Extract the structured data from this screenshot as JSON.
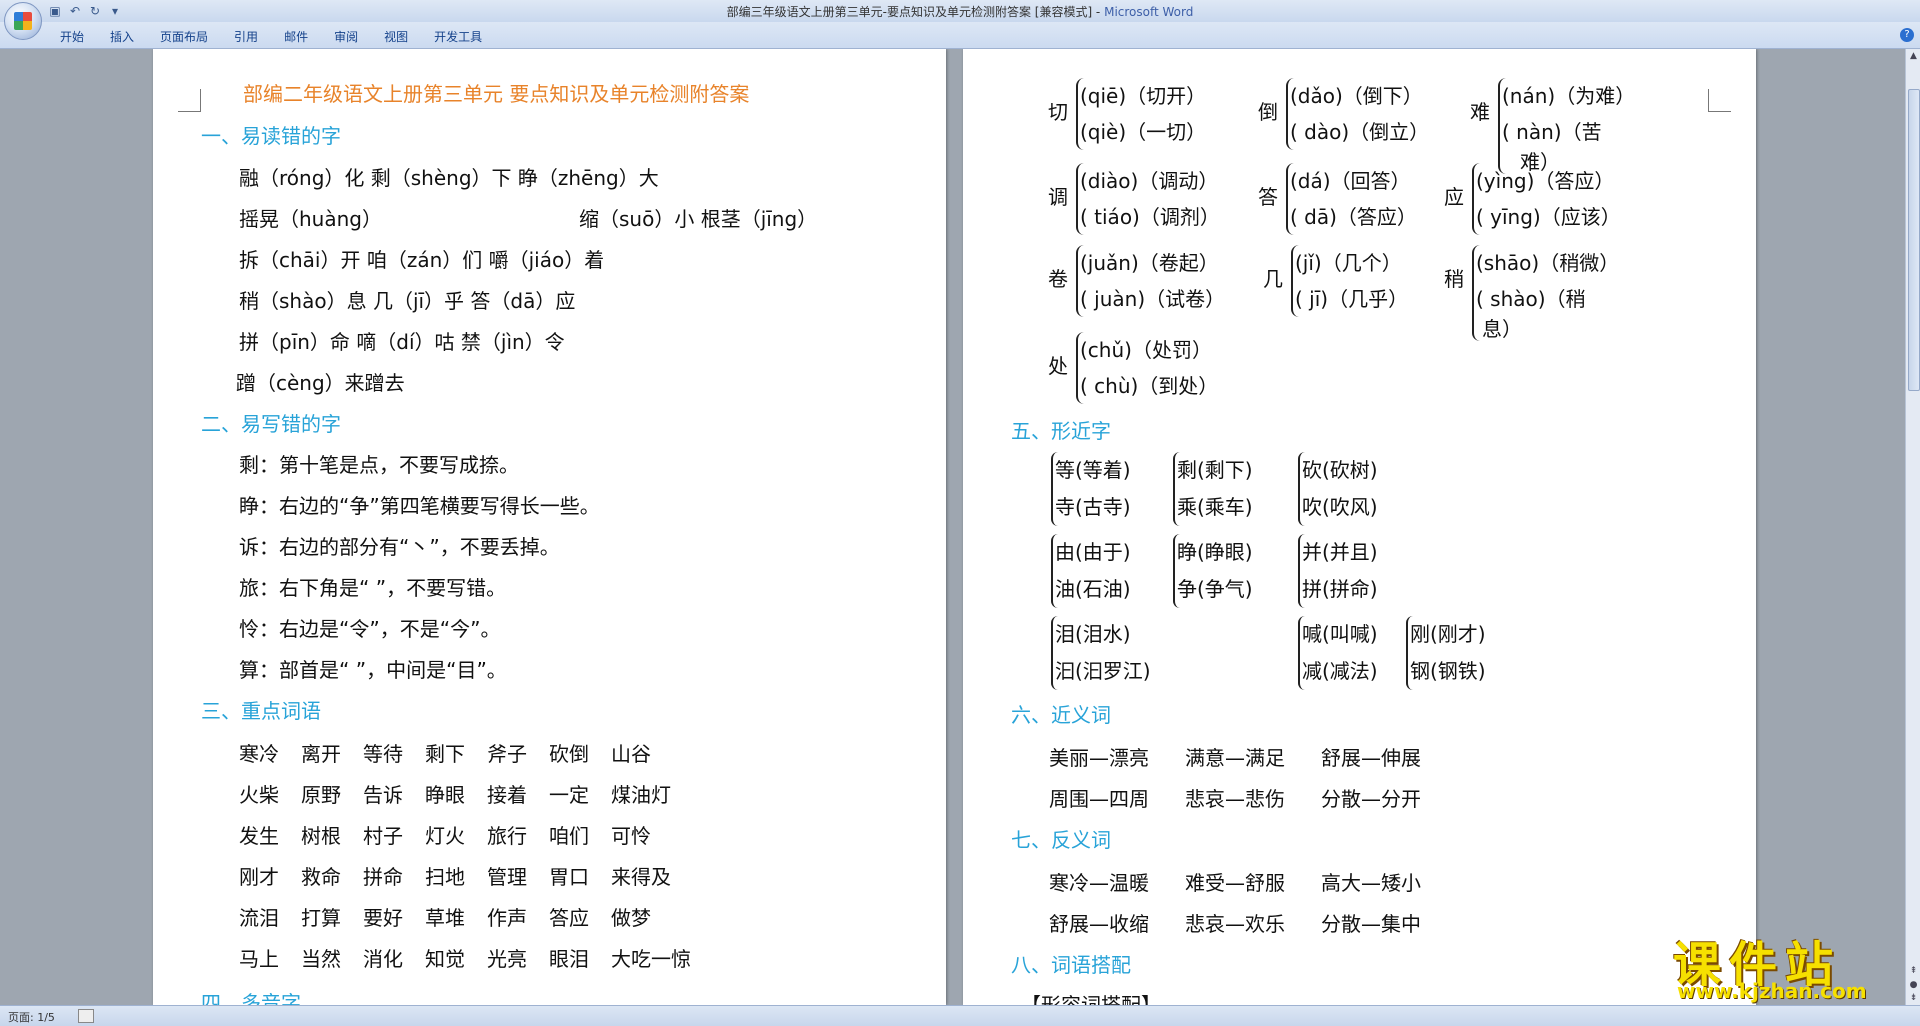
{
  "window": {
    "title": "部编三年级语文上册第三单元-要点知识及单元检测附答案 [兼容模式] - ",
    "app": "Microsoft Word"
  },
  "ribbon": {
    "tabs": [
      "开始",
      "插入",
      "页面布局",
      "引用",
      "邮件",
      "审阅",
      "视图",
      "开发工具"
    ]
  },
  "status": {
    "page": "页面: 1/5"
  },
  "watermark": {
    "brand": "课件站",
    "url": "www.kjzhan.com"
  },
  "doc": {
    "title": "部编二年级语文上册第三单元  要点知识及单元检测附答案",
    "s1": {
      "heading": "一、易读错的字",
      "lines": [
        "融（róng）化   剩（shèng）下   睁（zhēng）大",
        "摇晃（huàng）",
        "缩（suō）小     根茎（jīng）",
        "拆（chāi）开    咱（zán）们      嚼（jiáo）着",
        "稍（shào）息    几（jī）乎        答（dā）应",
        "拼（pīn）命     嘀（dí）咕        禁（jìn）令",
        "蹭（cèng）来蹭去"
      ]
    },
    "s2": {
      "heading": "二、易写错的字",
      "lines": [
        "剩：第十笔是点，不要写成捺。",
        "睁：右边的“争”第四笔横要写得长一些。",
        "诉：右边的部分有“丶”，不要丢掉。",
        "旅：右下角是“ ”，不要写错。",
        "怜：右边是“令”，不是“今”。",
        "算：部首是“  ”，中间是“目”。"
      ]
    },
    "s3": {
      "heading": "三、重点词语",
      "rows": [
        [
          "寒冷",
          "离开",
          "等待",
          "剩下",
          "斧子",
          "砍倒",
          "山谷"
        ],
        [
          "火柴",
          "原野",
          "告诉",
          "睁眼",
          "接着",
          "一定",
          "煤油灯"
        ],
        [
          "发生",
          "树根",
          "村子",
          "灯火",
          "旅行",
          "咱们",
          "可怜"
        ],
        [
          "刚才",
          "救命",
          "拼命",
          "扫地",
          "管理",
          "胃口",
          "来得及"
        ],
        [
          "流泪",
          "打算",
          "要好",
          "草堆",
          "作声",
          "答应",
          "做梦"
        ],
        [
          "马上",
          "当然",
          "消化",
          "知觉",
          "光亮",
          "眼泪",
          "大吃一惊"
        ]
      ]
    },
    "s4": {
      "heading": "四、多音字"
    },
    "poly": [
      {
        "ch": "切",
        "r1": "(qiē)（切开）",
        "r2": "(qiè)（一切）"
      },
      {
        "ch": "倒",
        "r1": "(dǎo)（倒下）",
        "r2": "( dào)（倒立）"
      },
      {
        "ch": "难",
        "r1": "(nán)（为难）",
        "r2": "( nàn)（苦",
        "r3": "难）"
      },
      {
        "ch": "调",
        "r1": "(diào)（调动）",
        "r2": "( tiáo)（调剂）"
      },
      {
        "ch": "答",
        "r1": "(dá)（回答）",
        "r2": "( dā)（答应）"
      },
      {
        "ch": "应",
        "r1": "(yìng)（答应）",
        "r2": "( yīng)（应该）"
      },
      {
        "ch": "卷",
        "r1": "(juǎn)（卷起）",
        "r2": "( juàn)（试卷）"
      },
      {
        "ch": "几",
        "r1": "(jǐ)（几个）",
        "r2": "( jī)（几乎）"
      },
      {
        "ch": "稍",
        "r1": "(shāo)（稍微）",
        "r2": "( shào)（稍",
        "r3": "息）"
      },
      {
        "ch": "处",
        "r1": "(chǔ)（处罚）",
        "r2": "( chù)（到处）"
      }
    ],
    "s5": {
      "heading": "五、形近字",
      "groups": [
        [
          "等(等着)",
          "寺(古寺)"
        ],
        [
          "剩(剩下)",
          "乘(乘车)"
        ],
        [
          "砍(砍树)",
          "吹(吹风)"
        ],
        [
          "由(由于)",
          "油(石油)"
        ],
        [
          "睁(睁眼)",
          "争(争气)"
        ],
        [
          "并(并且)",
          "拼(拼命)"
        ],
        [
          "泪(泪水)",
          "汩(汩罗江)"
        ],
        [
          "喊(叫喊)",
          "减(减法)"
        ],
        [
          "刚(刚才)",
          "钢(钢铁)"
        ]
      ]
    },
    "s6": {
      "heading": "六、近义词",
      "rows": [
        [
          "美丽—漂亮",
          "满意—满足",
          "舒展—伸展"
        ],
        [
          "周围—四周",
          "悲哀—悲伤",
          "分散—分开"
        ]
      ]
    },
    "s7": {
      "heading": "七、反义词",
      "rows": [
        [
          "寒冷—温暖",
          "难受—舒服",
          "高大—矮小"
        ],
        [
          "舒展—收缩",
          "悲哀—欢乐",
          "分散—集中"
        ]
      ]
    },
    "s8": {
      "heading": "八、词语搭配",
      "sub": "【形容词搭配】"
    }
  }
}
